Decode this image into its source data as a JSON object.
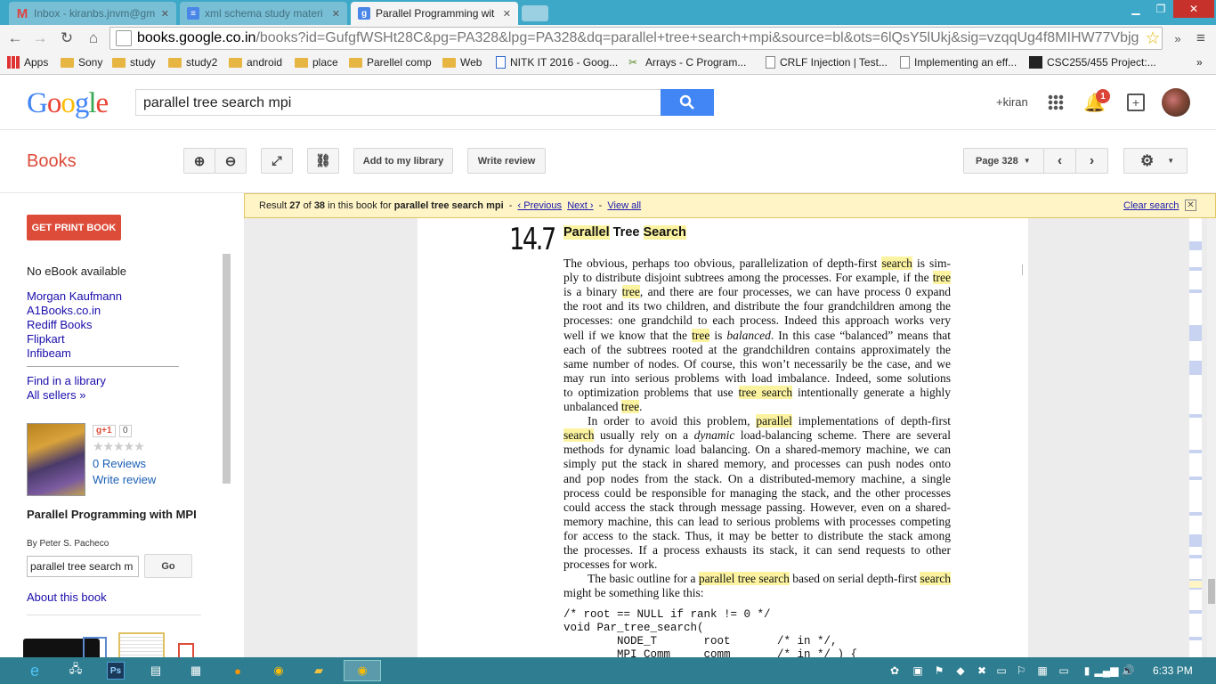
{
  "tabs": [
    {
      "title": "Inbox - kiranbs.jnvm@gm",
      "icon": "gmail-icon"
    },
    {
      "title": "xml schema study materi",
      "icon": "docs-icon"
    },
    {
      "title": "Parallel Programming wit",
      "icon": "google-icon"
    }
  ],
  "url": {
    "domain": "books.google.co.in",
    "path": "/books?id=GufgfWSHt28C&pg=PA328&lpg=PA328&dq=parallel+tree+search+mpi&source=bl&ots=6lQsY5lUkj&sig=vzqqUg4f8MIHW77Vbjg"
  },
  "bookmarks": [
    "Apps",
    "Sony",
    "study",
    "study2",
    "android",
    "place",
    "Parellel comp",
    "Web",
    "NITK IT 2016 - Goog...",
    "Arrays - C Program...",
    "CRLF Injection | Test...",
    "Implementing an eff...",
    "CSC255/455 Project:..."
  ],
  "header": {
    "logo": "Google",
    "query": "parallel tree search mpi",
    "user": "+kiran",
    "notifications": "1"
  },
  "books_bar": {
    "title": "Books",
    "add_library": "Add to my library",
    "write_review": "Write review",
    "page_select": "Page 328"
  },
  "sidebar": {
    "get_print": "GET PRINT BOOK",
    "no_ebook": "No eBook available",
    "sellers": [
      "Morgan Kaufmann",
      "A1Books.co.in",
      "Rediff Books",
      "Flipkart",
      "Infibeam"
    ],
    "find_library": "Find in a library",
    "all_sellers": "All sellers »",
    "gplus": "g+1",
    "gplus_count": "0",
    "reviews": "0 Reviews",
    "write_review": "Write review",
    "book_title": "Parallel Programming with MPI",
    "author": "By Peter S. Pacheco",
    "search_value": "parallel tree search m",
    "go": "Go",
    "about": "About this book"
  },
  "result_bar": {
    "prefix": "Result",
    "num": "27",
    "of": "of",
    "total": "38",
    "middle": "in this book for",
    "query": "parallel tree search mpi",
    "prev": "‹ Previous",
    "next": "Next ›",
    "view_all": "View all",
    "clear": "Clear search"
  },
  "page": {
    "section_num": "14.7",
    "heading": [
      "Parallel",
      "Tree",
      "Search"
    ],
    "lines": [
      [
        [
          "The obvious, perhaps too obvious, parallelization of depth-first ",
          0
        ],
        [
          "search",
          1
        ],
        [
          " is sim-",
          0
        ]
      ],
      [
        [
          "ply to distribute disjoint subtrees among the processes. For example, if the ",
          0
        ],
        [
          "tree",
          1
        ]
      ],
      [
        [
          "is a binary ",
          0
        ],
        [
          "tree",
          1
        ],
        [
          ", and there are four processes, we can have process 0 expand",
          0
        ]
      ],
      [
        [
          "the root and its two children, and distribute the four grandchildren among the",
          0
        ]
      ],
      [
        [
          "processes: one grandchild to each process. Indeed this approach works very",
          0
        ]
      ],
      [
        [
          "well if we know that the ",
          0
        ],
        [
          "tree",
          1
        ],
        [
          " is ",
          0
        ],
        [
          "balanced",
          2
        ],
        [
          ". In this case “balanced” means that",
          0
        ]
      ],
      [
        [
          "each of the subtrees rooted at the grandchildren contains approximately the",
          0
        ]
      ],
      [
        [
          "same number of nodes. Of course, this won’t necessarily be the case, and we",
          0
        ]
      ],
      [
        [
          "may run into serious problems with load imbalance. Indeed, some solutions",
          0
        ]
      ],
      [
        [
          "to optimization problems that use ",
          0
        ],
        [
          "tree search",
          1
        ],
        [
          " intentionally generate a highly",
          0
        ]
      ],
      [
        [
          "unbalanced ",
          0
        ],
        [
          "tree",
          1
        ],
        [
          ".",
          0
        ]
      ],
      [
        [
          "  In order to avoid this problem, ",
          0
        ],
        [
          "parallel",
          1
        ],
        [
          " implementations of depth-first",
          0
        ]
      ],
      [
        [
          "search",
          1
        ],
        [
          " usually rely on a ",
          0
        ],
        [
          "dynamic",
          2
        ],
        [
          " load-balancing scheme. There are several",
          0
        ]
      ],
      [
        [
          "methods for dynamic load balancing. On a shared-memory machine, we can",
          0
        ]
      ],
      [
        [
          "simply put the stack in shared memory, and processes can push nodes onto",
          0
        ]
      ],
      [
        [
          "and pop nodes from the stack. On a distributed-memory machine, a single",
          0
        ]
      ],
      [
        [
          "process could be responsible for managing the stack, and the other processes",
          0
        ]
      ],
      [
        [
          "could access the stack through message passing. However, even on a shared-",
          0
        ]
      ],
      [
        [
          "memory machine, this can lead to serious problems with processes competing",
          0
        ]
      ],
      [
        [
          "for access to the stack. Thus, it may be better to distribute the stack among",
          0
        ]
      ],
      [
        [
          "the processes. If a process exhausts its stack, it can send requests to other",
          0
        ]
      ],
      [
        [
          "processes for work.",
          0
        ]
      ],
      [
        [
          "  The basic outline for a ",
          0
        ],
        [
          "parallel tree search",
          1
        ],
        [
          " based on serial depth-first ",
          0
        ],
        [
          "search",
          1
        ]
      ],
      [
        [
          "might be something like this:",
          0
        ]
      ]
    ],
    "code": [
      "/* root == NULL if rank != 0 */",
      "void Par_tree_search(",
      "        NODE_T       root       /* in */,",
      "        MPI_Comm     comm       /* in */ ) {"
    ]
  },
  "taskbar": {
    "time": "6:33 PM"
  },
  "colors": {
    "tabstrip": "#3da8c8",
    "taskbar": "#2e7d90",
    "highlight": "#fbf3a0",
    "print_button": "#dd4b39",
    "books_title": "#dd4b39",
    "search_button": "#4285f4"
  }
}
